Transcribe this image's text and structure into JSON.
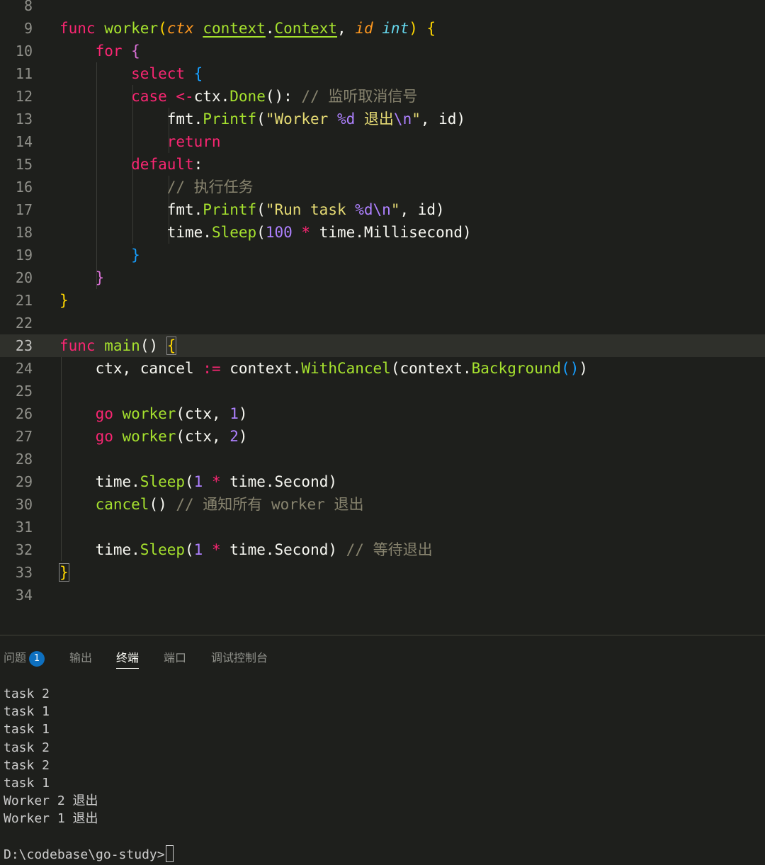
{
  "editor": {
    "current_line": 23,
    "lines": [
      {
        "n": "8",
        "tokens": []
      },
      {
        "n": "9",
        "tokens": [
          [
            "kw",
            "func"
          ],
          [
            "plain",
            " "
          ],
          [
            "fn",
            "worker"
          ],
          [
            "b1",
            "("
          ],
          [
            "param",
            "ctx"
          ],
          [
            "plain",
            " "
          ],
          [
            "typeu",
            "context"
          ],
          [
            "plain",
            "."
          ],
          [
            "typeu",
            "Context"
          ],
          [
            "plain",
            ", "
          ],
          [
            "param",
            "id"
          ],
          [
            "plain",
            " "
          ],
          [
            "type",
            "int"
          ],
          [
            "b1",
            ")"
          ],
          [
            "plain",
            " "
          ],
          [
            "b1",
            "{"
          ]
        ]
      },
      {
        "n": "10",
        "tokens": [
          [
            "plain",
            "    "
          ],
          [
            "kw",
            "for"
          ],
          [
            "plain",
            " "
          ],
          [
            "b2",
            "{"
          ]
        ]
      },
      {
        "n": "11",
        "tokens": [
          [
            "plain",
            "        "
          ],
          [
            "kw",
            "select"
          ],
          [
            "plain",
            " "
          ],
          [
            "b3",
            "{"
          ]
        ]
      },
      {
        "n": "12",
        "tokens": [
          [
            "plain",
            "        "
          ],
          [
            "kw",
            "case"
          ],
          [
            "plain",
            " "
          ],
          [
            "op",
            "<-"
          ],
          [
            "plain",
            "ctx."
          ],
          [
            "fn",
            "Done"
          ],
          [
            "plain",
            "(): "
          ],
          [
            "cm",
            "// 监听取消信号"
          ]
        ]
      },
      {
        "n": "13",
        "tokens": [
          [
            "plain",
            "            fmt."
          ],
          [
            "fn",
            "Printf"
          ],
          [
            "plain",
            "("
          ],
          [
            "str",
            "\"Worker "
          ],
          [
            "esc",
            "%d"
          ],
          [
            "str",
            " 退出"
          ],
          [
            "esc",
            "\\n"
          ],
          [
            "str",
            "\""
          ],
          [
            "plain",
            ", id)"
          ]
        ]
      },
      {
        "n": "14",
        "tokens": [
          [
            "plain",
            "            "
          ],
          [
            "kw",
            "return"
          ]
        ]
      },
      {
        "n": "15",
        "tokens": [
          [
            "plain",
            "        "
          ],
          [
            "kw",
            "default"
          ],
          [
            "plain",
            ":"
          ]
        ]
      },
      {
        "n": "16",
        "tokens": [
          [
            "plain",
            "            "
          ],
          [
            "cm",
            "// 执行任务"
          ]
        ]
      },
      {
        "n": "17",
        "tokens": [
          [
            "plain",
            "            fmt."
          ],
          [
            "fn",
            "Printf"
          ],
          [
            "plain",
            "("
          ],
          [
            "str",
            "\"Run task "
          ],
          [
            "esc",
            "%d\\n"
          ],
          [
            "str",
            "\""
          ],
          [
            "plain",
            ", id)"
          ]
        ]
      },
      {
        "n": "18",
        "tokens": [
          [
            "plain",
            "            time."
          ],
          [
            "fn",
            "Sleep"
          ],
          [
            "plain",
            "("
          ],
          [
            "num",
            "100"
          ],
          [
            "plain",
            " "
          ],
          [
            "op",
            "*"
          ],
          [
            "plain",
            " time.Millisecond)"
          ]
        ]
      },
      {
        "n": "19",
        "tokens": [
          [
            "plain",
            "        "
          ],
          [
            "b3",
            "}"
          ]
        ]
      },
      {
        "n": "20",
        "tokens": [
          [
            "plain",
            "    "
          ],
          [
            "b2",
            "}"
          ]
        ]
      },
      {
        "n": "21",
        "tokens": [
          [
            "b1",
            "}"
          ]
        ]
      },
      {
        "n": "22",
        "tokens": []
      },
      {
        "n": "23",
        "tokens": [
          [
            "kw",
            "func"
          ],
          [
            "plain",
            " "
          ],
          [
            "fn",
            "main"
          ],
          [
            "plain",
            "() "
          ],
          [
            "b1",
            "{"
          ]
        ]
      },
      {
        "n": "24",
        "tokens": [
          [
            "plain",
            "    ctx, cancel "
          ],
          [
            "op",
            ":="
          ],
          [
            "plain",
            " context."
          ],
          [
            "fn",
            "WithCancel"
          ],
          [
            "plain",
            "(context."
          ],
          [
            "fn",
            "Background"
          ],
          [
            "b3",
            "()"
          ],
          [
            "plain",
            ")"
          ]
        ]
      },
      {
        "n": "25",
        "tokens": []
      },
      {
        "n": "26",
        "tokens": [
          [
            "plain",
            "    "
          ],
          [
            "kw",
            "go"
          ],
          [
            "plain",
            " "
          ],
          [
            "fn",
            "worker"
          ],
          [
            "plain",
            "(ctx, "
          ],
          [
            "num",
            "1"
          ],
          [
            "plain",
            ")"
          ]
        ]
      },
      {
        "n": "27",
        "tokens": [
          [
            "plain",
            "    "
          ],
          [
            "kw",
            "go"
          ],
          [
            "plain",
            " "
          ],
          [
            "fn",
            "worker"
          ],
          [
            "plain",
            "(ctx, "
          ],
          [
            "num",
            "2"
          ],
          [
            "plain",
            ")"
          ]
        ]
      },
      {
        "n": "28",
        "tokens": []
      },
      {
        "n": "29",
        "tokens": [
          [
            "plain",
            "    time."
          ],
          [
            "fn",
            "Sleep"
          ],
          [
            "plain",
            "("
          ],
          [
            "num",
            "1"
          ],
          [
            "plain",
            " "
          ],
          [
            "op",
            "*"
          ],
          [
            "plain",
            " time.Second)"
          ]
        ]
      },
      {
        "n": "30",
        "tokens": [
          [
            "plain",
            "    "
          ],
          [
            "fn",
            "cancel"
          ],
          [
            "plain",
            "() "
          ],
          [
            "cm",
            "// 通知所有 worker 退出"
          ]
        ]
      },
      {
        "n": "31",
        "tokens": []
      },
      {
        "n": "32",
        "tokens": [
          [
            "plain",
            "    time."
          ],
          [
            "fn",
            "Sleep"
          ],
          [
            "plain",
            "("
          ],
          [
            "num",
            "1"
          ],
          [
            "plain",
            " "
          ],
          [
            "op",
            "*"
          ],
          [
            "plain",
            " time.Second) "
          ],
          [
            "cm",
            "// 等待退出"
          ]
        ]
      },
      {
        "n": "33",
        "tokens": [
          [
            "b1",
            "}"
          ]
        ]
      },
      {
        "n": "34",
        "tokens": []
      }
    ]
  },
  "panel": {
    "tabs": [
      {
        "label": "问题",
        "badge": "1",
        "active": false
      },
      {
        "label": "输出",
        "active": false
      },
      {
        "label": "终端",
        "active": true
      },
      {
        "label": "端口",
        "active": false
      },
      {
        "label": "调试控制台",
        "active": false
      }
    ],
    "terminal_lines": [
      "task 2",
      "task 1",
      "task 1",
      "task 2",
      "task 2",
      "task 1",
      "Worker 2 退出",
      "Worker 1 退出"
    ],
    "prompt": "D:\\codebase\\go-study>"
  }
}
